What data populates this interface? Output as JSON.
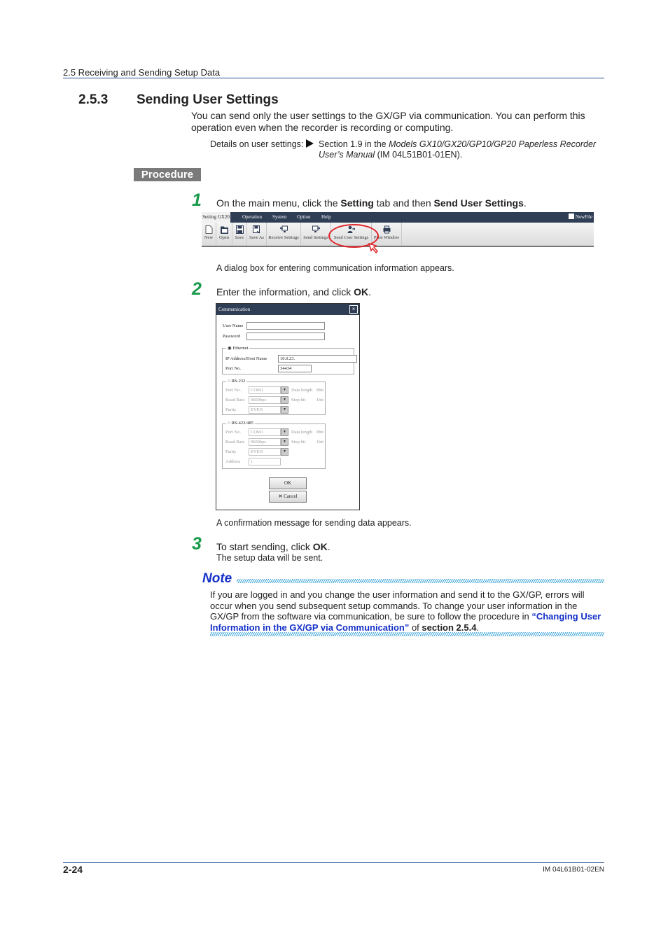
{
  "header": {
    "section_path": "2.5  Receiving and Sending Setup Data"
  },
  "section": {
    "number": "2.5.3",
    "title": "Sending User Settings",
    "intro": "You can send only the user settings to the GX/GP via communication. You can perform this operation even when the recorder is recording or computing.",
    "reference": {
      "label": "Details on user settings:",
      "text_prefix": "Section 1.9 in the ",
      "manual_title": "Models GX10/GX20/GP10/GP20 Paperless Recorder User’s Manual",
      "text_suffix": " (IM 04L51B01-01EN)."
    }
  },
  "procedure_label": "Procedure",
  "steps": [
    {
      "number": "1",
      "text_a": "On the main menu, click the ",
      "bold_a": "Setting",
      "text_b": " tab and then ",
      "bold_b": "Send User Settings",
      "text_c": ".",
      "result": "A dialog box for entering communication information appears."
    },
    {
      "number": "2",
      "text_a": "Enter the information, and click ",
      "bold_a": "OK",
      "text_c": ".",
      "result": "A confirmation message for sending data appears."
    },
    {
      "number": "3",
      "text_a": "To start sending, click ",
      "bold_a": "OK",
      "text_c": ".",
      "result": "The setup data will be sent."
    }
  ],
  "toolbar": {
    "tabs": [
      "Setting GX20",
      "Operation",
      "System",
      "Option",
      "Help"
    ],
    "newfile": "NewFile",
    "buttons": [
      {
        "label": "New",
        "icon": "new-file-icon"
      },
      {
        "label": "Open",
        "icon": "folder-open-icon"
      },
      {
        "label": "Save",
        "icon": "save-icon"
      },
      {
        "label": "Save As",
        "icon": "save-as-icon"
      },
      {
        "label": "Receive Settings",
        "icon": "receive-settings-icon"
      },
      {
        "label": "Send Settings",
        "icon": "send-settings-icon"
      },
      {
        "label": "Send User Settings",
        "icon": "send-user-settings-icon"
      },
      {
        "label": "Print Window",
        "icon": "printer-icon"
      }
    ],
    "highlight_color": "#e0242a"
  },
  "dialog": {
    "title": "Communication",
    "user_name_label": "User Name",
    "user_name_value": "",
    "password_label": "Password",
    "password_value": "",
    "ethernet": {
      "label": "Ethernet",
      "selected": true,
      "ip_label": "IP Address/Host Name",
      "ip_value": "10.0.23.",
      "port_label": "Port No.",
      "port_value": "34434"
    },
    "rs232": {
      "label": "RS-232",
      "selected": false,
      "port_label": "Port No.",
      "port_value": "COM1",
      "baud_label": "Baud Rate",
      "baud_value": "9600bps",
      "parity_label": "Parity",
      "parity_value": "EVEN",
      "data_length_label": "Data length",
      "data_length_value": "8bit",
      "stop_bit_label": "Stop bit",
      "stop_bit_value": "1bit"
    },
    "rs422": {
      "label": "RS-422/485",
      "selected": false,
      "port_label": "Port No.",
      "port_value": "COM1",
      "baud_label": "Baud Rate",
      "baud_value": "9600bps",
      "parity_label": "Parity",
      "parity_value": "EVEN",
      "address_label": "Address",
      "address_value": "1",
      "data_length_label": "Data length",
      "data_length_value": "8bit",
      "stop_bit_label": "Stop bit",
      "stop_bit_value": "1bit"
    },
    "ok_label": "OK",
    "cancel_label": "Cancel"
  },
  "note": {
    "title": "Note",
    "text_a": "If you are logged in and you change the user information and send it to the GX/GP, errors will occur when you send subsequent setup commands. To change your user information in the GX/GP from the software via communication, be sure to follow the procedure in ",
    "link": "“Changing User Information in the GX/GP via Communication”",
    "text_b": " of ",
    "bold": "section 2.5.4",
    "text_c": "."
  },
  "footer": {
    "page": "2-24",
    "doc_id": "IM 04L61B01-02EN"
  },
  "colors": {
    "rule": "#1f4e96",
    "step_number": "#1a9a4a",
    "note_blue": "#1430c8",
    "hatch": "#3aa3d6"
  }
}
